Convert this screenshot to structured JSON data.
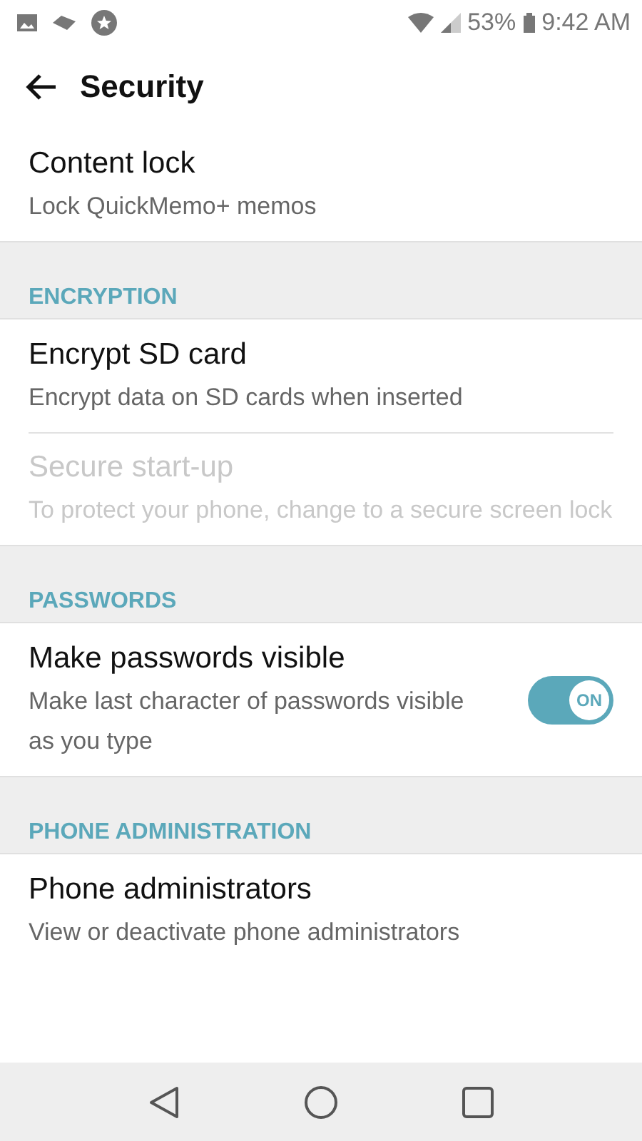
{
  "status_bar": {
    "battery": "53%",
    "time": "9:42 AM"
  },
  "header": {
    "title": "Security"
  },
  "sections": [
    {
      "items": [
        {
          "title": "Content lock",
          "subtitle": "Lock QuickMemo+ memos",
          "disabled": false
        }
      ]
    },
    {
      "heading": "ENCRYPTION",
      "items": [
        {
          "title": "Encrypt SD card",
          "subtitle": "Encrypt data on SD cards when inserted",
          "disabled": false
        },
        {
          "title": "Secure start-up",
          "subtitle": "To protect your phone, change to a secure screen lock",
          "disabled": true
        }
      ]
    },
    {
      "heading": "PASSWORDS",
      "items": [
        {
          "title": "Make passwords visible",
          "subtitle": "Make last character of passwords visible as you type",
          "disabled": false,
          "toggle": {
            "on": true,
            "label": "ON"
          }
        }
      ]
    },
    {
      "heading": "PHONE ADMINISTRATION",
      "items": [
        {
          "title": "Phone administrators",
          "subtitle": "View or deactivate phone administrators",
          "disabled": false
        }
      ]
    }
  ]
}
